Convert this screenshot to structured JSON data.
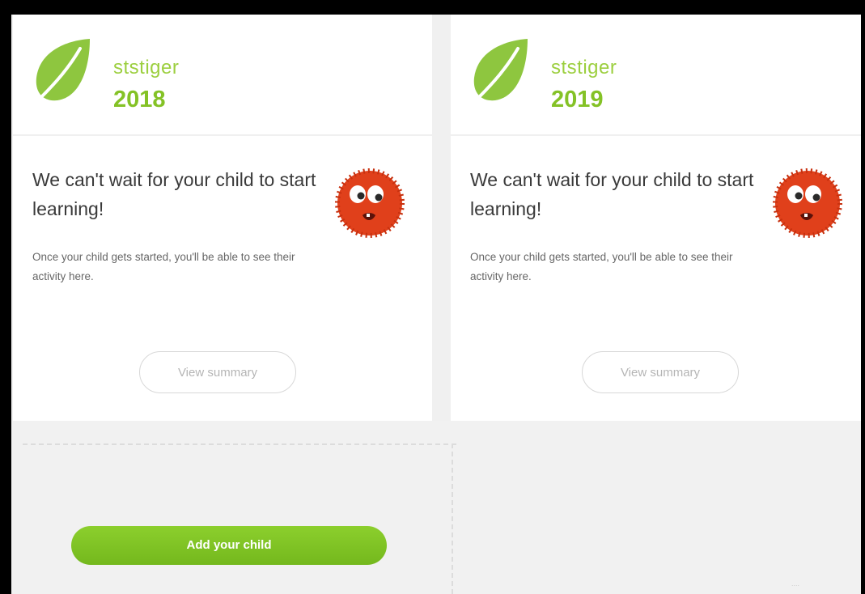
{
  "colors": {
    "leaf": "#8ec63f",
    "username": "#9ccf3f",
    "year": "#84c226",
    "add_button": "#7ec225",
    "monster": "#e0401b"
  },
  "cards": [
    {
      "username": "ststiger",
      "year": "2018",
      "headline": "We can't wait for your child to start learning!",
      "subtext": "Once your child gets started, you'll be able to see their activity here.",
      "button_label": "View summary",
      "icons": [
        "leaf-logo-icon",
        "monster-mascot-icon"
      ]
    },
    {
      "username": "ststiger",
      "year": "2019",
      "headline": "We can't wait for your child to start learning!",
      "subtext": "Once your child gets started, you'll be able to see their activity here.",
      "button_label": "View summary",
      "icons": [
        "leaf-logo-icon",
        "monster-mascot-icon"
      ]
    }
  ],
  "add_child": {
    "label": "Add your child"
  },
  "footer": {
    "text": "...."
  }
}
